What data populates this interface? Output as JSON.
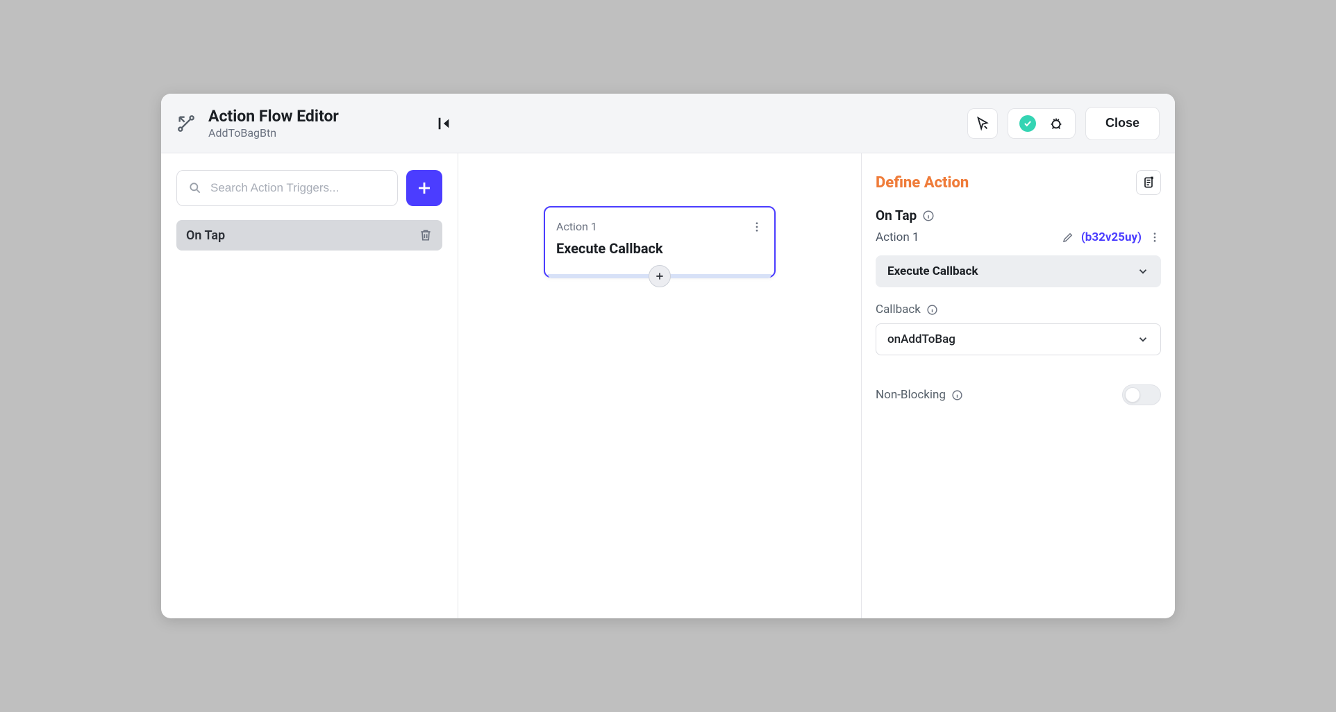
{
  "header": {
    "title": "Action Flow Editor",
    "subtitle": "AddToBagBtn",
    "close_label": "Close"
  },
  "sidebar": {
    "search_placeholder": "Search Action Triggers...",
    "triggers": [
      {
        "label": "On Tap"
      }
    ]
  },
  "canvas": {
    "cards": [
      {
        "subtitle": "Action 1",
        "title": "Execute Callback"
      }
    ]
  },
  "panel": {
    "heading": "Define Action",
    "trigger_name": "On Tap",
    "action_label": "Action 1",
    "action_hash": "(b32v25uy)",
    "action_type": "Execute Callback",
    "callback_field_label": "Callback",
    "callback_value": "onAddToBag",
    "non_blocking_label": "Non-Blocking",
    "non_blocking_value": false
  }
}
